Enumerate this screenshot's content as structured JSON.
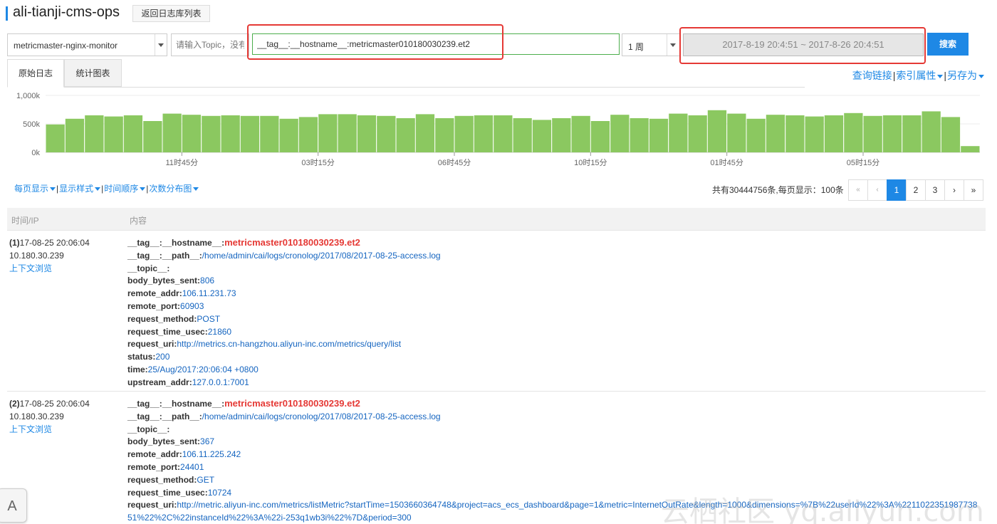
{
  "header": {
    "title": "ali-tianji-cms-ops",
    "back_button": "返回日志库列表"
  },
  "toolbar": {
    "logstore": "metricmaster-nginx-monitor",
    "topic_placeholder": "请输入Topic，没有",
    "query": "__tag__:__hostname__:metricmaster010180030239.et2",
    "range": "1 周",
    "time_range": "2017-8-19 20:4:51 ~ 2017-8-26 20:4:51",
    "search_label": "搜索"
  },
  "tabs": [
    {
      "label": "原始日志"
    },
    {
      "label": "统计图表"
    }
  ],
  "right_links": {
    "query_link": "查询链接",
    "index_attr": "索引属性",
    "save_as": "另存为"
  },
  "chart_data": {
    "type": "bar",
    "y_ticks": [
      "1,000k",
      "500k",
      "0k"
    ],
    "ylim": [
      0,
      1000
    ],
    "x_tick_labels": [
      "11时45分",
      "03时15分",
      "06时45分",
      "10时15分",
      "01时45分",
      "05时15分"
    ],
    "x_tick_index": [
      7,
      14,
      21,
      28,
      35,
      42
    ],
    "values": [
      490,
      590,
      650,
      630,
      650,
      550,
      680,
      660,
      640,
      650,
      640,
      640,
      590,
      620,
      670,
      670,
      650,
      640,
      600,
      670,
      600,
      640,
      650,
      650,
      600,
      570,
      600,
      640,
      550,
      660,
      600,
      590,
      680,
      650,
      740,
      680,
      590,
      660,
      650,
      630,
      650,
      690,
      640,
      650,
      650,
      720,
      620,
      110
    ],
    "color": "#8bc860"
  },
  "controls": {
    "per_page": "每页显示",
    "display_style": "显示样式",
    "time_order": "时间顺序",
    "distribution": "次数分布图",
    "total": "共有30444756条,每页显示：100条",
    "pages": [
      "«",
      "‹",
      "1",
      "2",
      "3",
      "›",
      "»"
    ]
  },
  "table": {
    "col_time": "时间/IP",
    "col_content": "内容"
  },
  "rows": [
    {
      "index": "(1)",
      "time": "17-08-25 20:06:04",
      "ip": "10.180.30.239",
      "context": "上下文浏览",
      "fields": [
        {
          "k": "__tag__:__hostname__:",
          "v": "metricmaster010180030239.et2",
          "red": true
        },
        {
          "k": "__tag__:__path__:",
          "v": "/home/admin/cai/logs/cronolog/2017/08/2017-08-25-access.log"
        },
        {
          "k": "__topic__:",
          "v": ""
        },
        {
          "k": "body_bytes_sent:",
          "v": "806"
        },
        {
          "k": "remote_addr:",
          "v": "106.11.231.73"
        },
        {
          "k": "remote_port:",
          "v": "60903"
        },
        {
          "k": "request_method:",
          "v": "POST"
        },
        {
          "k": "request_time_usec:",
          "v": "21860"
        },
        {
          "k": "request_uri:",
          "v": "http://metrics.cn-hangzhou.aliyun-inc.com/metrics/query/list"
        },
        {
          "k": "status:",
          "v": "200"
        },
        {
          "k": "time:",
          "v": "25/Aug/2017:20:06:04 +0800"
        },
        {
          "k": "upstream_addr:",
          "v": "127.0.0.1:7001"
        }
      ]
    },
    {
      "index": "(2)",
      "time": "17-08-25 20:06:04",
      "ip": "10.180.30.239",
      "context": "上下文浏览",
      "fields": [
        {
          "k": "__tag__:__hostname__:",
          "v": "metricmaster010180030239.et2",
          "red": true
        },
        {
          "k": "__tag__:__path__:",
          "v": "/home/admin/cai/logs/cronolog/2017/08/2017-08-25-access.log"
        },
        {
          "k": "__topic__:",
          "v": ""
        },
        {
          "k": "body_bytes_sent:",
          "v": "367"
        },
        {
          "k": "remote_addr:",
          "v": "106.11.225.242"
        },
        {
          "k": "remote_port:",
          "v": "24401"
        },
        {
          "k": "request_method:",
          "v": "GET"
        },
        {
          "k": "request_time_usec:",
          "v": "10724"
        },
        {
          "k": "request_uri:",
          "v": "http://metric.aliyun-inc.com/metrics/listMetric?startTime=1503660364748&project=acs_ecs_dashboard&page=1&metric=InternetOutRate&length=1000&dimensions=%7B%22userId%22%3A%2211022351987738\n51%22%2C%22instanceId%22%3A%22i-253q1wb3i%22%7D&period=300"
        }
      ]
    }
  ],
  "font_button": "A",
  "watermark": "云栖社区 yq.aliyun.com"
}
